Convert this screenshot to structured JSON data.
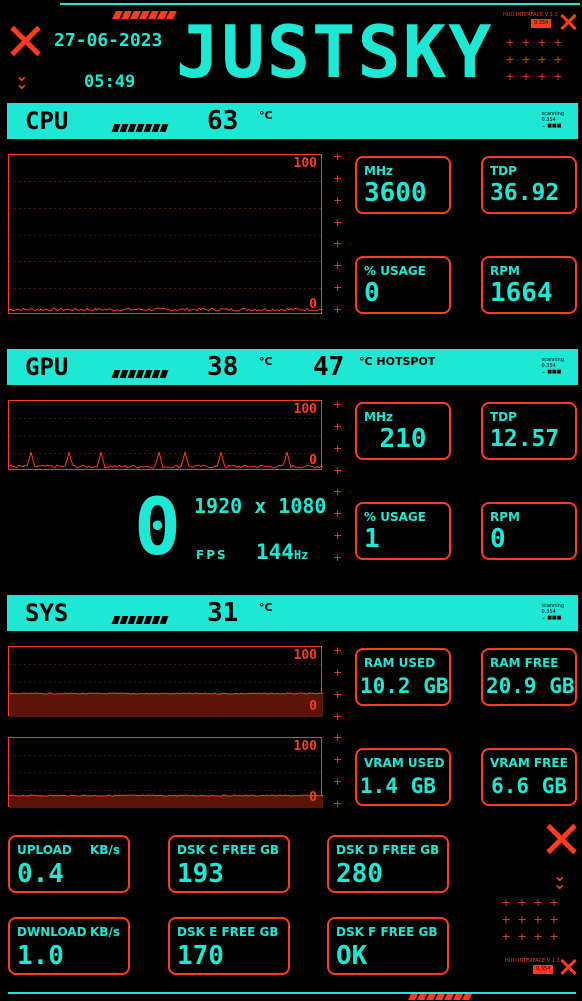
{
  "header": {
    "date": "27-06-2023",
    "time": "05:49",
    "brand": "JUSTSKY",
    "tag_top": "HUD INTERFACE V 1.3",
    "tag_top_box": "0.354",
    "tag_bottom": "HUD INTERFACE V 1.3",
    "tag_bottom_box": "0.354"
  },
  "cpu": {
    "name": "CPU",
    "temp": "63",
    "temp_unit": "°C",
    "mini_label": "scanning\n0.354",
    "graph_max": "100",
    "graph_min": "0",
    "mhz_label": "MHz",
    "mhz_value": "3600",
    "tdp_label": "TDP",
    "tdp_value": "36.92",
    "usage_label": "% USAGE",
    "usage_value": "0",
    "rpm_label": "RPM",
    "rpm_value": "1664"
  },
  "gpu": {
    "name": "GPU",
    "temp": "38",
    "temp_unit": "°C",
    "hotspot": "47",
    "hotspot_unit": "°C HOTSPOT",
    "graph_max": "100",
    "graph_min": "0",
    "fps": "0",
    "resolution": "1920 x 1080",
    "fps_label": "FPS",
    "refresh": "144",
    "refresh_unit": "Hz",
    "mhz_label": "MHz",
    "mhz_value": "210",
    "tdp_label": "TDP",
    "tdp_value": "12.57",
    "usage_label": "% USAGE",
    "usage_value": "1",
    "rpm_label": "RPM",
    "rpm_value": "0"
  },
  "sys": {
    "name": "SYS",
    "temp": "31",
    "temp_unit": "°C",
    "graph1_max": "100",
    "graph1_min": "0",
    "graph2_max": "100",
    "graph2_min": "0",
    "ram_used_label": "RAM USED",
    "ram_used_value": "10.2 GB",
    "ram_free_label": "RAM FREE",
    "ram_free_value": "20.9 GB",
    "vram_used_label": "VRAM USED",
    "vram_used_value": "1.4 GB",
    "vram_free_label": "VRAM FREE",
    "vram_free_value": "6.6 GB"
  },
  "net": {
    "upload_label": "UPLOAD",
    "upload_unit": "KB/s",
    "upload_value": "0.4",
    "download_label": "DWNLOAD",
    "download_unit": "KB/s",
    "download_value": "1.0"
  },
  "disks": {
    "c_label": "DSK C FREE GB",
    "c_value": "193",
    "d_label": "DSK D FREE GB",
    "d_value": "280",
    "e_label": "DSK E FREE GB",
    "e_value": "170",
    "f_label": "DSK F FREE GB",
    "f_value": "OK"
  },
  "colors": {
    "accent": "#1ee8d4",
    "alert": "#ff3a1e",
    "background": "#000000"
  }
}
